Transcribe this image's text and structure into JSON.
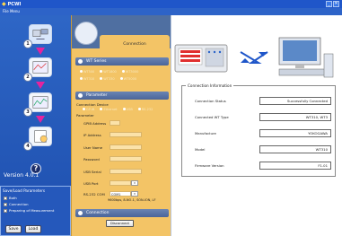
{
  "window": {
    "title": "PCWI",
    "menu": "File Menu"
  },
  "nav": {
    "version": "Version 4.0.1"
  },
  "save_load": {
    "title": "Save/Load Parameters",
    "options": [
      "Both",
      "Connection",
      "Preparing of Measurement"
    ],
    "save_label": "Save",
    "load_label": "Load"
  },
  "config": {
    "tab_label": "Connection",
    "wt_series_label": "WT Series",
    "parameter_label": "Parameter",
    "connection_device_label": "Connection Device",
    "param_label": "Parameter",
    "fields": {
      "gpib_address": "GPIB Address",
      "ip_address": "IP Address",
      "user_name": "User Name",
      "password": "Password",
      "usb_serial": "USB Serial",
      "usb_port": "USB Port",
      "rs232_com": "RS-232 COM"
    },
    "com_value": "COM1",
    "rs232_settings": "9600bps, 8-NO-1, SON-ION, LF",
    "connection_label": "Connection",
    "disconnect_label": "Disconnect"
  },
  "info": {
    "title": "Connection Information",
    "rows": [
      {
        "label": "Connection Status",
        "value": "Successfully Connected"
      },
      {
        "label": "Connected WT Type",
        "value": "WT310, WT3"
      },
      {
        "label": "Manufacture",
        "value": "YOKOGAWA"
      },
      {
        "label": "Model",
        "value": "WT310"
      },
      {
        "label": "Firmware Version",
        "value": "F1.01"
      }
    ]
  }
}
